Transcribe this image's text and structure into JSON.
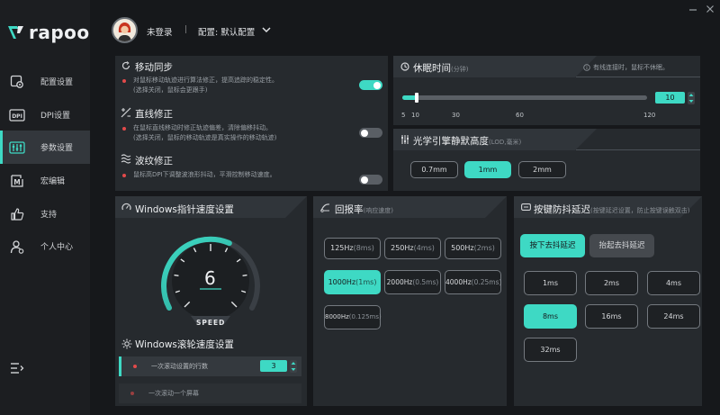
{
  "brand": {
    "name": "rapoo"
  },
  "sidebar": {
    "items": [
      {
        "label": "配置设置",
        "icon": "config-icon"
      },
      {
        "label": "DPI设置",
        "icon": "dpi-icon"
      },
      {
        "label": "参数设置",
        "icon": "params-icon"
      },
      {
        "label": "宏编辑",
        "icon": "macro-icon"
      },
      {
        "label": "支持",
        "icon": "thumbs-up-icon"
      },
      {
        "label": "个人中心",
        "icon": "user-icon"
      }
    ]
  },
  "header": {
    "user": "未登录",
    "profile": "配置: 默认配置"
  },
  "sections": {
    "motion_sync": {
      "title": "移动同步",
      "desc": "对鼠标移动轨迹进行算法修正，提高追踪的稳定性。",
      "desc2": "(选择关闭，鼠标会更跟手)",
      "on": true
    },
    "angle_snap": {
      "title": "直线修正",
      "desc": "在鼠标直线移动时修正轨迹偏差，清除偏移抖动。",
      "desc2": "(选择关闭，鼠标的移动轨迹是真实操作的移动轨迹)",
      "on": false
    },
    "ripple": {
      "title": "波纹修正",
      "desc": "鼠标高DPI下调整波浪形抖动，平滑控制移动速度。",
      "on": false
    },
    "sleep": {
      "title": "休眠时间",
      "unit": "(分钟)",
      "note": "有线连接时，鼠标不休眠。",
      "value": 10,
      "min": 5,
      "max": 120,
      "ticks": [
        "5",
        "10",
        "30",
        "60",
        "120"
      ]
    },
    "lod": {
      "title": "光学引擎静默高度",
      "unit": "(LOD,毫米)",
      "options": [
        "0.7mm",
        "1mm",
        "2mm"
      ],
      "selected": "1mm"
    },
    "pointer": {
      "title": "Windows指针速度设置",
      "value": "6",
      "speed_label": "SPEED",
      "level": 0.6
    },
    "polling": {
      "title": "回报率",
      "unit": "(响应速度)",
      "options": [
        {
          "main": "125Hz",
          "sub": "(8ms)"
        },
        {
          "main": "250Hz",
          "sub": "(4ms)"
        },
        {
          "main": "500Hz",
          "sub": "(2ms)"
        },
        {
          "main": "1000Hz",
          "sub": "(1ms)"
        },
        {
          "main": "2000Hz",
          "sub": "(0.5ms)"
        },
        {
          "main": "4000Hz",
          "sub": "(0.25ms)"
        },
        {
          "main": "8000Hz",
          "sub": "(0.125ms)"
        }
      ],
      "selected": "1000Hz"
    },
    "debounce": {
      "title": "按键防抖延迟",
      "unit": "(按键延迟设置，防止按键误触双击)",
      "tabs": [
        "按下去抖延迟",
        "抬起去抖延迟"
      ],
      "options": [
        "1ms",
        "2ms",
        "4ms",
        "8ms",
        "16ms",
        "24ms",
        "32ms"
      ],
      "selected": "8ms"
    },
    "scroll": {
      "title": "Windows滚轮速度设置",
      "rows": [
        {
          "label": "一次滚动设置的行数",
          "value": "3"
        },
        {
          "label": "一次滚动一个屏幕"
        }
      ]
    }
  },
  "colors": {
    "accent": "#3ed9c4",
    "bg": "#16181b",
    "panel": "#262a2e",
    "bullet": "#e24a4a"
  }
}
